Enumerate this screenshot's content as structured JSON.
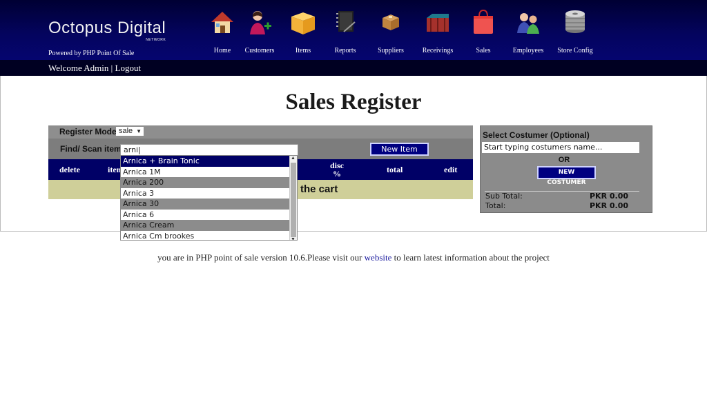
{
  "header": {
    "logo_text": "Octopus Digital",
    "logo_sub": "NETWORK",
    "powered_by": "Powered by PHP Point Of Sale",
    "welcome": "Welcome Admin",
    "separator": "|",
    "logout": "Logout"
  },
  "nav": [
    {
      "label": "Home",
      "icon": "house-icon"
    },
    {
      "label": "Customers",
      "icon": "customer-add-icon"
    },
    {
      "label": "Items",
      "icon": "box-icon"
    },
    {
      "label": "Reports",
      "icon": "notebook-icon"
    },
    {
      "label": "Suppliers",
      "icon": "package-icon"
    },
    {
      "label": "Receivings",
      "icon": "crate-icon"
    },
    {
      "label": "Sales",
      "icon": "shopping-bag-icon"
    },
    {
      "label": "Employees",
      "icon": "employees-icon"
    },
    {
      "label": "Store Config",
      "icon": "disk-stack-icon"
    }
  ],
  "page": {
    "title": "Sales Register"
  },
  "register": {
    "mode_label": "Register Mode",
    "mode_value": "sale",
    "find_label": "Find/ Scan item",
    "find_value": "arni|",
    "new_item_button": "New Item",
    "columns": {
      "delete": "delete",
      "item": "item",
      "disc": "disc",
      "pct": "%",
      "total": "total",
      "edit": "edit"
    },
    "cart_message": "the cart"
  },
  "autocomplete": {
    "items": [
      "Arnica + Brain Tonic",
      "Arnica 1M",
      "Arnica 200",
      "Arnica 3",
      "Arnica 30",
      "Arnica 6",
      "Arnica Cream",
      "Arnica Cm brookes"
    ]
  },
  "customer": {
    "title": "Select Costumer (Optional)",
    "input_value": "Start typing costumers name...",
    "or": "OR",
    "new_button": "NEW COSTUMER",
    "subtotal_label": "Sub Total:",
    "subtotal_value": "PKR 0.00",
    "total_label": "Total:",
    "total_value": "PKR 0.00"
  },
  "footer": {
    "text_before": "you are in PHP point of sale version 10.6.Please visit our",
    "link": "website",
    "text_after": "to learn latest information about the project"
  }
}
